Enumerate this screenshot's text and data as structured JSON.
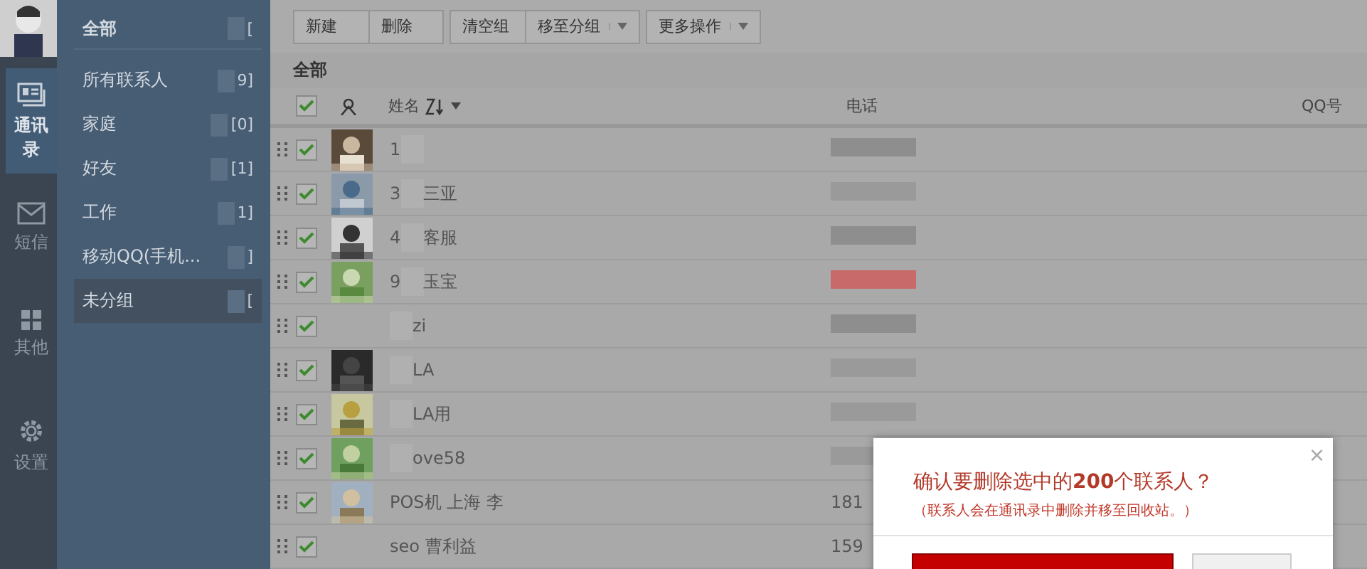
{
  "nav": [
    {
      "label": "通讯录",
      "selected": true
    },
    {
      "label": "短信",
      "selected": false
    },
    {
      "label": "其他",
      "selected": false
    },
    {
      "label": "设置",
      "selected": false
    }
  ],
  "groups": [
    {
      "label": "全部",
      "count": "[",
      "selected": false,
      "kind": "header"
    },
    {
      "label": "所有联系人",
      "count": "9]",
      "selected": false,
      "kind": "item"
    },
    {
      "label": "家庭",
      "count": "[0]",
      "selected": false,
      "kind": "item"
    },
    {
      "label": "好友",
      "count": "[1]",
      "selected": false,
      "kind": "item"
    },
    {
      "label": "工作",
      "count": "1]",
      "selected": false,
      "kind": "item"
    },
    {
      "label": "移动QQ(手机...",
      "count": "]",
      "selected": false,
      "kind": "item"
    },
    {
      "label": "未分组",
      "count": "[",
      "selected": true,
      "kind": "item"
    }
  ],
  "toolbar": [
    [
      {
        "label": "新建",
        "dropdown": false
      },
      {
        "label": "删除",
        "dropdown": false
      }
    ],
    [
      {
        "label": "清空组",
        "dropdown": false
      },
      {
        "label": "移至分组",
        "dropdown": true
      }
    ],
    [
      {
        "label": "更多操作",
        "dropdown": true
      }
    ]
  ],
  "list_title": "全部",
  "columns": {
    "all_checked": true,
    "name": "姓名",
    "phone": "电话",
    "qq": "QQ号"
  },
  "rows": [
    {
      "checked": true,
      "avatar": true,
      "prefix": "1",
      "color": "#8e8e8e"
    },
    {
      "checked": true,
      "avatar": true,
      "prefix": "3",
      "suffix": "三亚",
      "color": "#9a9a9a"
    },
    {
      "checked": true,
      "avatar": true,
      "prefix": "4",
      "suffix": "客服",
      "color": "#8e8e8e"
    },
    {
      "checked": true,
      "avatar": true,
      "prefix": "9",
      "suffix": "玉宝",
      "color": "#c86a6a"
    },
    {
      "checked": true,
      "avatar": false,
      "suffix": "zi",
      "color": "#8e8e8e"
    },
    {
      "checked": true,
      "avatar": true,
      "suffix": "LA",
      "color": "#9a9a9a"
    },
    {
      "checked": true,
      "avatar": true,
      "suffix": "LA用",
      "color": "#9a9a9a"
    },
    {
      "checked": true,
      "avatar": true,
      "suffix": "ove58",
      "color": "#9a9a9a"
    },
    {
      "checked": true,
      "avatar": true,
      "prefix": "POS机 上海 李",
      "phone": "181"
    },
    {
      "checked": true,
      "avatar": false,
      "prefix": "seo 曹利益",
      "phone": "159"
    }
  ],
  "dialog": {
    "title": "确认要删除选中的**200**个联系人？",
    "note": "（联系人会在通讯录中删除并移至回收站。）",
    "close": "×",
    "buttons": [
      {
        "kind": "primary"
      },
      {
        "kind": "secondary"
      }
    ]
  }
}
